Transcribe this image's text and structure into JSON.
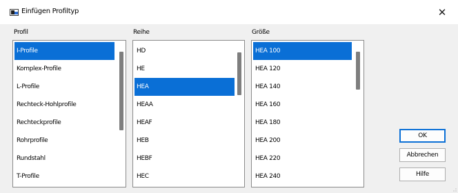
{
  "window": {
    "title": "Einfügen Profiltyp",
    "close_glyph": "✕"
  },
  "labels": {
    "profil": "Profil",
    "reihe": "Reihe",
    "groesse": "Größe"
  },
  "profil": {
    "items": [
      "I-Profile",
      "Komplex-Profile",
      "L-Profile",
      "Rechteck-Hohlprofile",
      "Rechteckprofile",
      "Rohrprofile",
      "Rundstahl",
      "T-Profile"
    ],
    "selected": "I-Profile"
  },
  "reihe": {
    "items": [
      "HD",
      "HE",
      "HEA",
      "HEAA",
      "HEAF",
      "HEB",
      "HEBF",
      "HEC"
    ],
    "selected": "HEA"
  },
  "groesse": {
    "items": [
      "HEA 100",
      "HEA 120",
      "HEA 140",
      "HEA 160",
      "HEA 180",
      "HEA 200",
      "HEA 220",
      "HEA 240"
    ],
    "selected": "HEA 100"
  },
  "buttons": {
    "ok": "OK",
    "cancel": "Abbrechen",
    "help": "Hilfe"
  },
  "colors": {
    "selection": "#0a6fd6",
    "dialog_bg": "#f0f0f0"
  }
}
